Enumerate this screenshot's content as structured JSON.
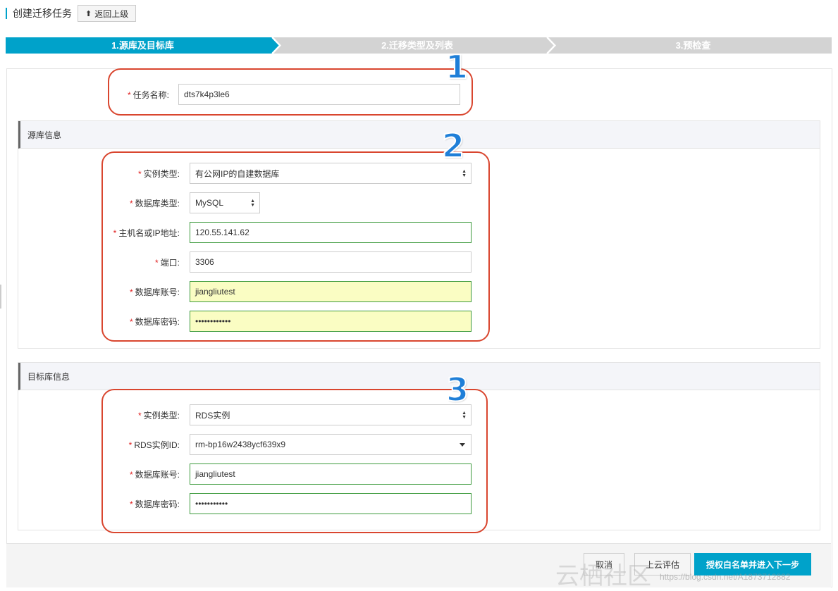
{
  "header": {
    "title": "创建迁移任务",
    "back_label": "返回上级"
  },
  "steps": [
    {
      "label": "1.源库及目标库",
      "active": true
    },
    {
      "label": "2.迁移类型及列表",
      "active": false
    },
    {
      "label": "3.预检查",
      "active": false
    }
  ],
  "task": {
    "name_label": "任务名称:",
    "name_value": "dts7k4p3le6"
  },
  "source": {
    "title": "源库信息",
    "instance_type_label": "实例类型:",
    "instance_type_value": "有公网IP的自建数据库",
    "db_type_label": "数据库类型:",
    "db_type_value": "MySQL",
    "host_label": "主机名或IP地址:",
    "host_value": "120.55.141.62",
    "port_label": "端口:",
    "port_value": "3306",
    "account_label": "数据库账号:",
    "account_value": "jiangliutest",
    "password_label": "数据库密码:",
    "password_value": "••••••••••••"
  },
  "target": {
    "title": "目标库信息",
    "instance_type_label": "实例类型:",
    "instance_type_value": "RDS实例",
    "rds_id_label": "RDS实例ID:",
    "rds_id_value": "rm-bp16w2438ycf639x9",
    "account_label": "数据库账号:",
    "account_value": "jiangliutest",
    "password_label": "数据库密码:",
    "password_value": "•••••••••••"
  },
  "annotations": [
    "1",
    "2",
    "3"
  ],
  "footer": {
    "cancel": "取消",
    "evaluate": "上云评估",
    "next": "授权白名单并进入下一步"
  },
  "watermark": {
    "main": "云栖社区",
    "url": "https://blog.csdn.net/A1873712882"
  },
  "colors": {
    "accent": "#00a2ca",
    "annotation_box": "#d9462f",
    "annotation_num": "#1f7fd8",
    "required": "#e02020"
  }
}
